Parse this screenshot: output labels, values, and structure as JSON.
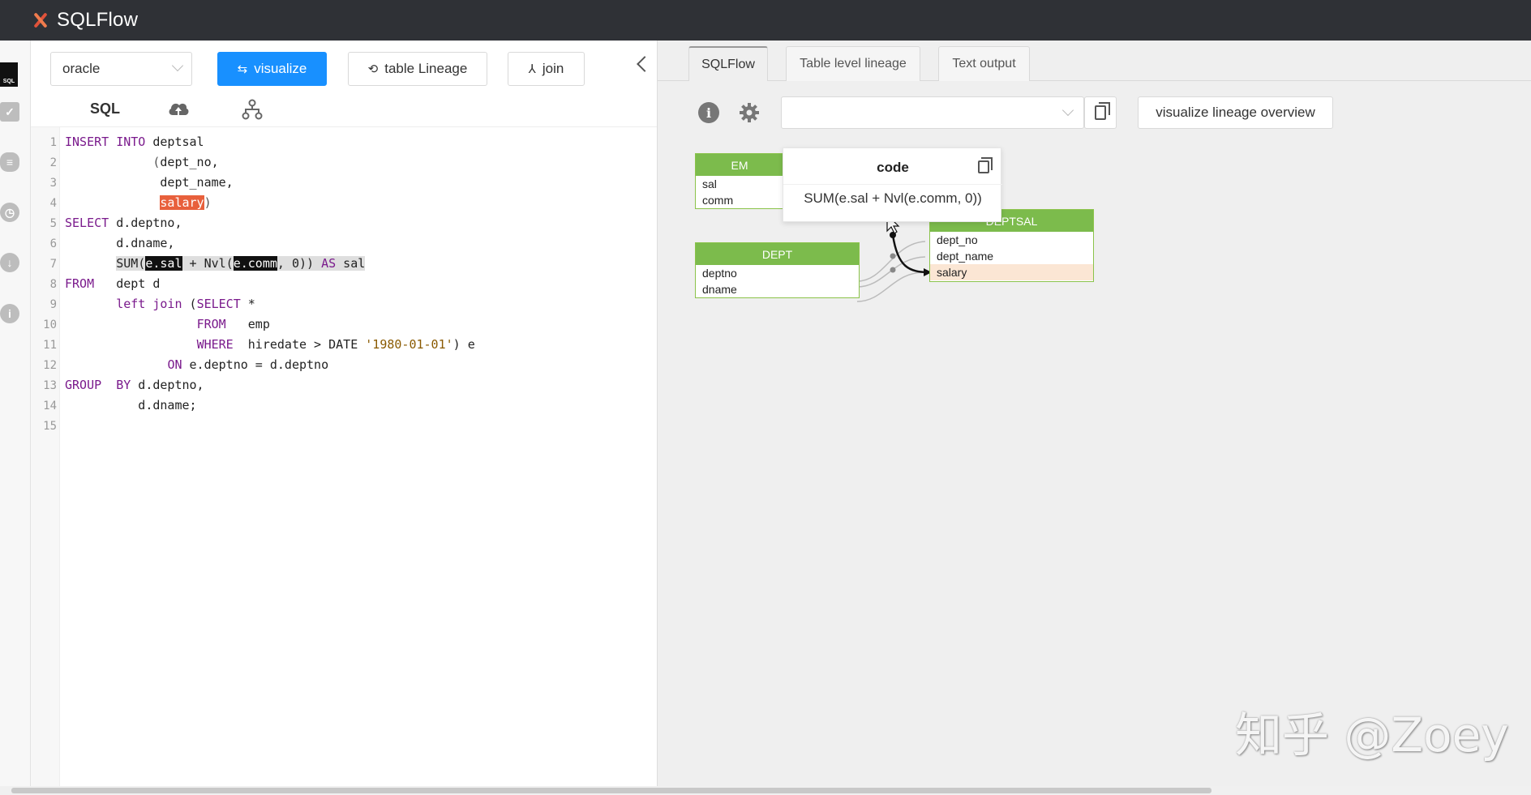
{
  "app": {
    "title": "SQLFlow"
  },
  "rail": {
    "sql_badge": "SQL"
  },
  "toolbar": {
    "dialect": "oracle",
    "visualize_label": "visualize",
    "table_lineage_label": "table Lineage",
    "join_label": "join"
  },
  "editor": {
    "sql_tab_label": "SQL",
    "line_numbers": [
      "1",
      "2",
      "3",
      "4",
      "5",
      "6",
      "7",
      "8",
      "9",
      "10",
      "11",
      "12",
      "13",
      "14",
      "15"
    ]
  },
  "right": {
    "tabs": [
      "SQLFlow",
      "Table level lineage",
      "Text output"
    ],
    "overview_label": "visualize lineage overview"
  },
  "diagram": {
    "emp": {
      "header": "EM",
      "columns": [
        "sal",
        "comm"
      ]
    },
    "dept": {
      "header": "DEPT",
      "columns": [
        "deptno",
        "dname"
      ]
    },
    "deptsal": {
      "header": "DEPTSAL",
      "columns": [
        "dept_no",
        "dept_name",
        "salary"
      ]
    },
    "popup": {
      "title": "code",
      "text": "SUM(e.sal + Nvl(e.comm, 0))"
    }
  },
  "watermark": "知乎 @Zoey"
}
